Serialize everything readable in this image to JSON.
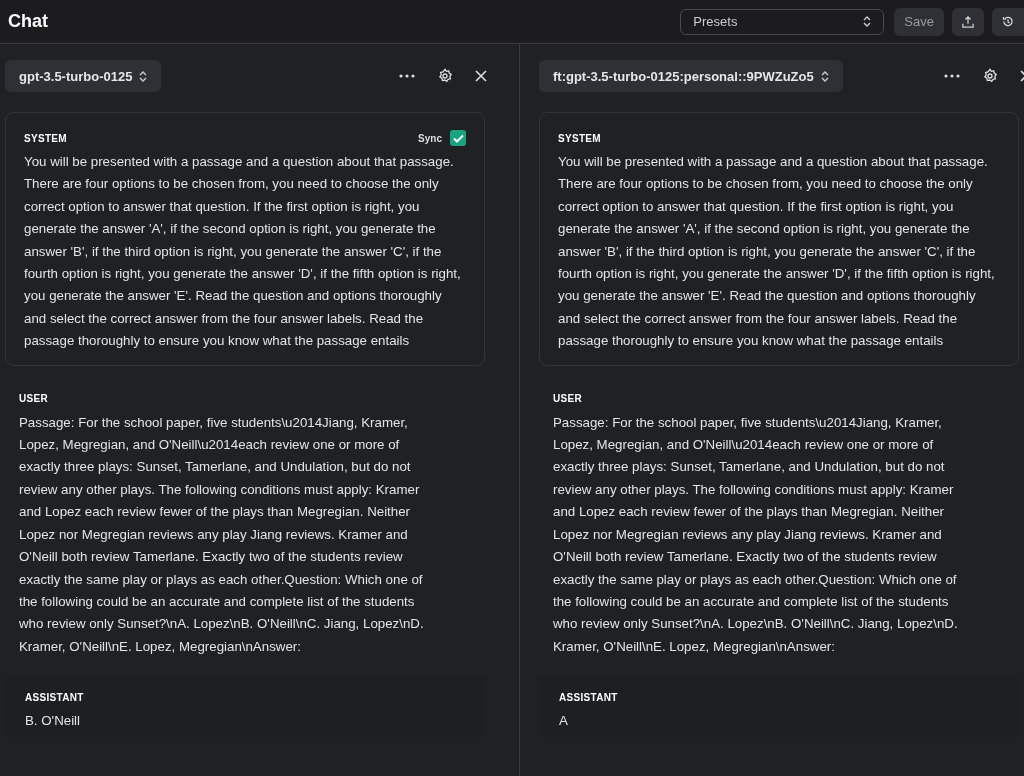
{
  "header": {
    "title": "Chat",
    "presets": {
      "label": "Presets"
    },
    "save": "Save"
  },
  "panels": [
    {
      "model": "gpt-3.5-turbo-0125",
      "messages": [
        {
          "kind": "system",
          "role": "SYSTEM",
          "sync": {
            "label": "Sync",
            "checked": true
          },
          "text": "You will be presented with a passage and a question about that passage. There are four options to be chosen from, you need to choose the only correct option to answer that question. If the first option is right, you generate the answer 'A', if the second option is right, you generate the answer 'B', if the third option is right, you generate the answer 'C', if the fourth option is right, you generate the answer 'D', if the fifth option is right, you generate the answer 'E'. Read the question and options thoroughly and select the correct answer from the four answer labels. Read the passage thoroughly to ensure you know what the passage entails"
        },
        {
          "kind": "user",
          "role": "USER",
          "text": "Passage: For the school paper, five students\\u2014Jiang, Kramer, Lopez, Megregian, and O'Neill\\u2014each review one or more of exactly three plays: Sunset, Tamerlane, and Undulation, but do not review any other plays. The following conditions must apply: Kramer and Lopez each review fewer of the plays than Megregian. Neither Lopez nor Megregian reviews any play Jiang reviews. Kramer and O'Neill both review Tamerlane. Exactly two of the students review exactly the same play or plays as each other.Question: Which one of the following could be an accurate and complete list of the students who review only Sunset?\\nA. Lopez\\nB. O'Neill\\nC. Jiang, Lopez\\nD. Kramer, O'Neill\\nE. Lopez, Megregian\\nAnswer:"
        },
        {
          "kind": "assistant",
          "role": "ASSISTANT",
          "text": "B. O'Neill"
        }
      ]
    },
    {
      "model": "ft:gpt-3.5-turbo-0125:personal::9PWZuZo5",
      "messages": [
        {
          "kind": "system",
          "role": "SYSTEM",
          "text": "You will be presented with a passage and a question about that passage. There are four options to be chosen from, you need to choose the only correct option to answer that question. If the first option is right, you generate the answer 'A', if the second option is right, you generate the answer 'B', if the third option is right, you generate the answer 'C', if the fourth option is right, you generate the answer 'D', if the fifth option is right, you generate the answer 'E'. Read the question and options thoroughly and select the correct answer from the four answer labels. Read the passage thoroughly to ensure you know what the passage entails"
        },
        {
          "kind": "user",
          "role": "USER",
          "text": "Passage: For the school paper, five students\\u2014Jiang, Kramer, Lopez, Megregian, and O'Neill\\u2014each review one or more of exactly three plays: Sunset, Tamerlane, and Undulation, but do not review any other plays. The following conditions must apply: Kramer and Lopez each review fewer of the plays than Megregian. Neither Lopez nor Megregian reviews any play Jiang reviews. Kramer and O'Neill both review Tamerlane. Exactly two of the students review exactly the same play or plays as each other.Question: Which one of the following could be an accurate and complete list of the students who review only Sunset?\\nA. Lopez\\nB. O'Neill\\nC. Jiang, Lopez\\nD. Kramer, O'Neill\\nE. Lopez, Megregian\\nAnswer:"
        },
        {
          "kind": "assistant",
          "role": "ASSISTANT",
          "text": "A"
        }
      ]
    }
  ]
}
